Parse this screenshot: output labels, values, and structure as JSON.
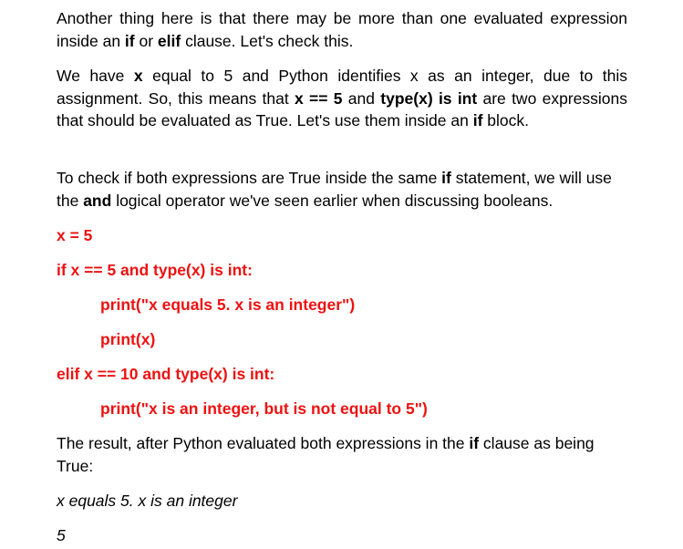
{
  "paragraphs": {
    "p1": {
      "t1": "Another thing here is that there may be more than one evaluated expression inside an ",
      "b1": "if",
      "t2": " or ",
      "b2": "elif",
      "t3": " clause. Let's check this."
    },
    "p2": {
      "t1": "We have ",
      "b1": "x",
      "t2": " equal to 5 and Python identifies x as an integer, due to this assignment. So, this means that ",
      "b2": "x == 5",
      "t3": " and ",
      "b3": "type(x) is int",
      "t4": " are two expressions that should be evaluated as True. Let's use them inside an ",
      "b4": "if",
      "t5": " block."
    },
    "p3": {
      "t1": "To check if both expressions are True inside the same ",
      "b1": "if",
      "t2": " statement, we will use the ",
      "b2": "and",
      "t3": " logical operator we've seen earlier when discussing booleans."
    },
    "p4": {
      "t1": "The result, after Python evaluated both expressions in the ",
      "b1": "if",
      "t2": " clause as being True:"
    }
  },
  "code": [
    "x = 5",
    "if x == 5 and type(x) is int:",
    "print(\"x equals 5. x is an integer\")",
    "print(x)",
    "elif x == 10 and type(x) is int:",
    "print(\"x is an integer, but is not equal to 5\")"
  ],
  "output": [
    "x equals 5. x is an integer",
    "5"
  ],
  "colors": {
    "code": "#ee1111",
    "text": "#000000"
  }
}
